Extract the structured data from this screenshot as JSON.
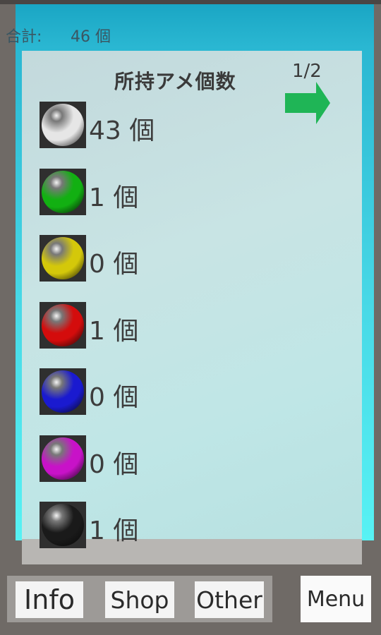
{
  "header": {
    "total_label": "合計:",
    "total_value": "46 個"
  },
  "panel": {
    "title": "所持アメ個数",
    "page_indicator": "1/2",
    "next_icon": "right-arrow-icon",
    "candies": [
      {
        "color_name": "white",
        "color": "#e6e6e6",
        "count": "43 個"
      },
      {
        "color_name": "green",
        "color": "#12b012",
        "count": "1 個"
      },
      {
        "color_name": "yellow",
        "color": "#d4c80a",
        "count": "0 個"
      },
      {
        "color_name": "red",
        "color": "#d40c0c",
        "count": "1 個"
      },
      {
        "color_name": "blue",
        "color": "#1a1ad0",
        "count": "0 個"
      },
      {
        "color_name": "magenta",
        "color": "#c812c8",
        "count": "0 個"
      },
      {
        "color_name": "black",
        "color": "#1a1a1a",
        "count": "1 個"
      }
    ]
  },
  "toolbar": {
    "info_label": "Info",
    "shop_label": "Shop",
    "other_label": "Other",
    "menu_label": "Menu"
  },
  "colors": {
    "arrow": "#1fb556"
  }
}
